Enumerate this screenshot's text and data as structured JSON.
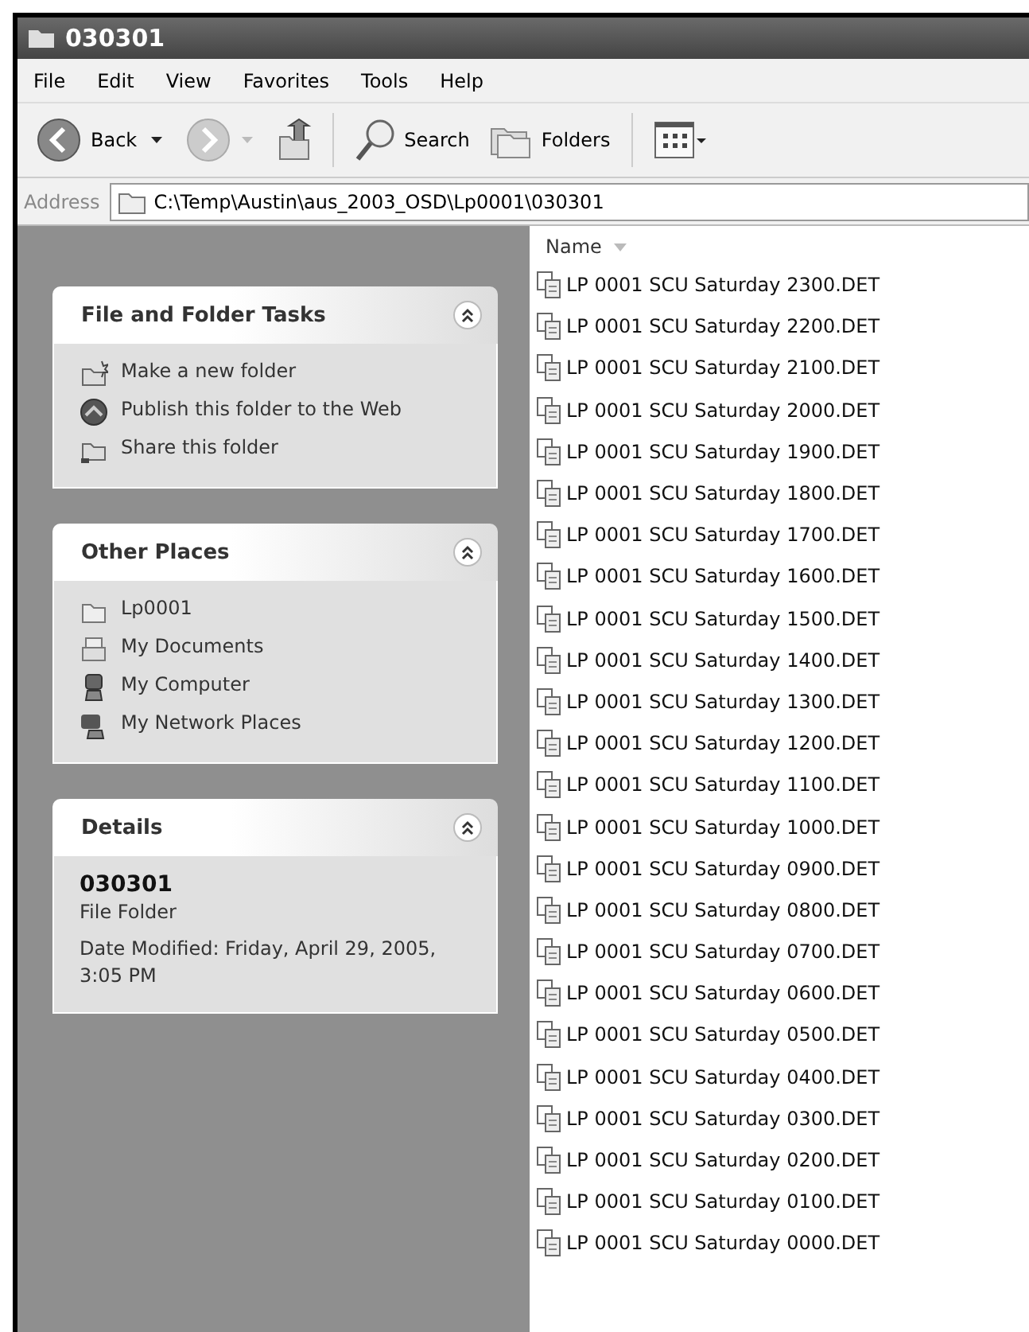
{
  "window": {
    "title": "030301"
  },
  "menu": [
    "File",
    "Edit",
    "View",
    "Favorites",
    "Tools",
    "Help"
  ],
  "toolbar": {
    "back": "Back",
    "search": "Search",
    "folders": "Folders"
  },
  "address": {
    "label": "Address",
    "value": "C:\\Temp\\Austin\\aus_2003_OSD\\Lp0001\\030301"
  },
  "panels": [
    {
      "title": "File and Folder Tasks",
      "expanded": true,
      "kind": "links",
      "items": [
        {
          "label": "Make a new folder"
        },
        {
          "label": "Publish this folder to the Web"
        },
        {
          "label": "Share this folder"
        }
      ]
    },
    {
      "title": "Other Places",
      "expanded": true,
      "kind": "links",
      "items": [
        {
          "label": "Lp0001"
        },
        {
          "label": "My Documents"
        },
        {
          "label": "My Computer"
        },
        {
          "label": "My Network Places"
        }
      ]
    },
    {
      "title": "Details",
      "expanded": true,
      "kind": "details",
      "name": "030301",
      "type": "File Folder",
      "modified": "Date Modified: Friday, April 29, 2005, 3:05 PM"
    }
  ],
  "list": {
    "column": "Name",
    "files": [
      "LP 0001 SCU Saturday 2300.DET",
      "LP 0001 SCU Saturday 2200.DET",
      "LP 0001 SCU Saturday 2100.DET",
      "LP 0001 SCU Saturday 2000.DET",
      "LP 0001 SCU Saturday 1900.DET",
      "LP 0001 SCU Saturday 1800.DET",
      "LP 0001 SCU Saturday 1700.DET",
      "LP 0001 SCU Saturday 1600.DET",
      "LP 0001 SCU Saturday 1500.DET",
      "LP 0001 SCU Saturday 1400.DET",
      "LP 0001 SCU Saturday 1300.DET",
      "LP 0001 SCU Saturday 1200.DET",
      "LP 0001 SCU Saturday 1100.DET",
      "LP 0001 SCU Saturday 1000.DET",
      "LP 0001 SCU Saturday 0900.DET",
      "LP 0001 SCU Saturday 0800.DET",
      "LP 0001 SCU Saturday 0700.DET",
      "LP 0001 SCU Saturday 0600.DET",
      "LP 0001 SCU Saturday 0500.DET",
      "LP 0001 SCU Saturday 0400.DET",
      "LP 0001 SCU Saturday 0300.DET",
      "LP 0001 SCU Saturday 0200.DET",
      "LP 0001 SCU Saturday 0100.DET",
      "LP 0001 SCU Saturday 0000.DET"
    ]
  }
}
